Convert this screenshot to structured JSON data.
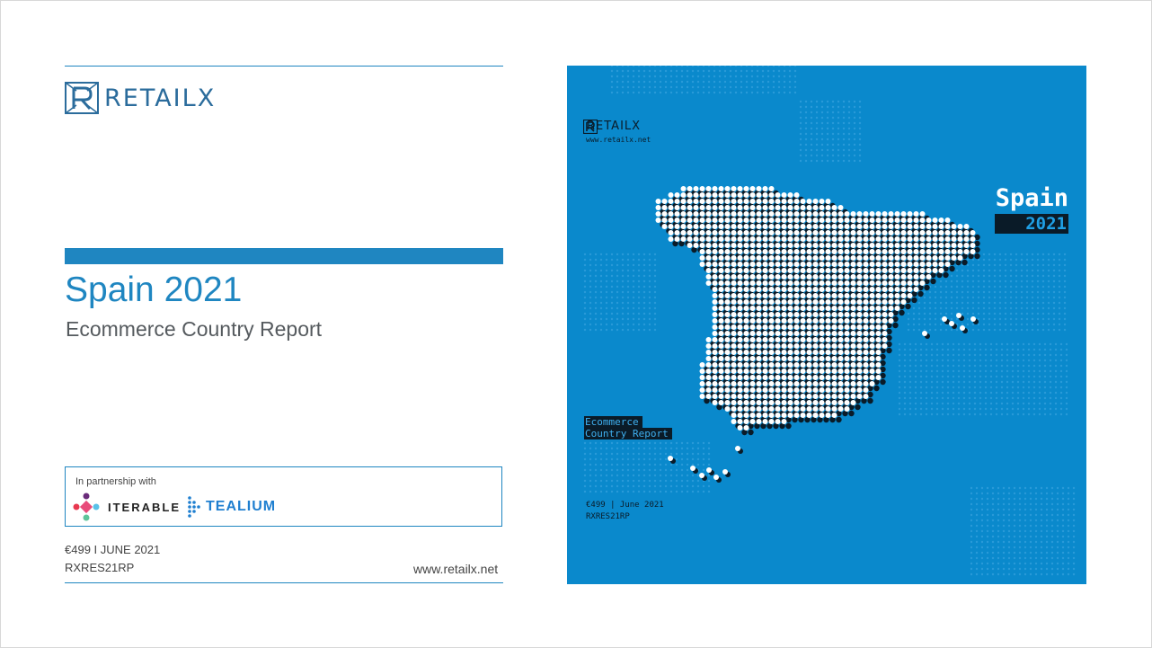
{
  "brand": {
    "name": "RETAILX",
    "website": "www.retailx.net"
  },
  "report": {
    "title": "Spain 2021",
    "subtitle": "Ecommerce Country Report",
    "price_date": "€499 I JUNE 2021",
    "code": "RXRES21RP"
  },
  "partners": {
    "label": "In partnership with",
    "items": [
      {
        "name": "ITERABLE",
        "color": "#2a2a2a"
      },
      {
        "name": "TEALIUM",
        "color": "#1f7fd0"
      }
    ]
  },
  "cover": {
    "brand": "RETAILX",
    "url": "www.retailx.net",
    "title": "Spain",
    "year": "2021",
    "subtitle_line1": "Ecommerce",
    "subtitle_line2": "Country Report",
    "price_date": "€499 | June 2021",
    "code": "RXRES21RP",
    "background_color": "#0a89cc"
  },
  "colors": {
    "accent": "#1f86c1",
    "text": "#555a5e"
  }
}
